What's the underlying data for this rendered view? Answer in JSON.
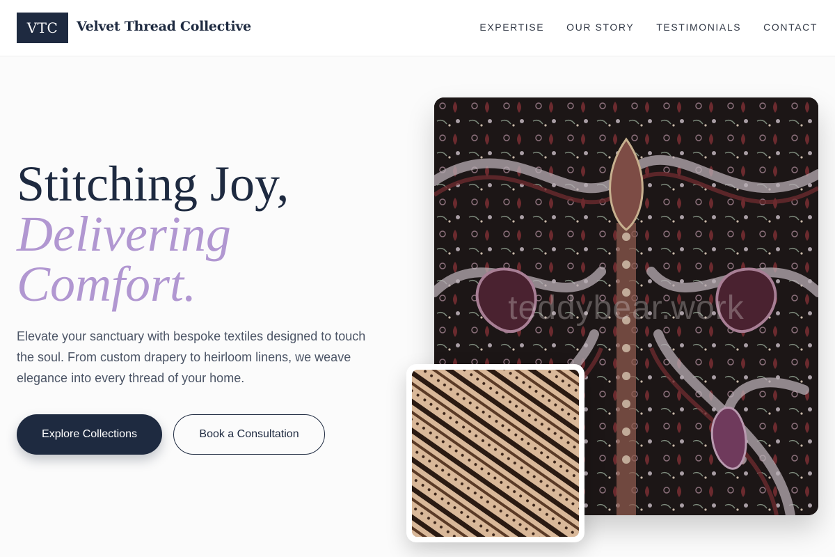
{
  "brand": {
    "logo_text": "VTC",
    "name": "Velvet Thread Collective"
  },
  "nav": {
    "items": [
      {
        "label": "EXPERTISE"
      },
      {
        "label": "OUR STORY"
      },
      {
        "label": "TESTIMONIALS"
      },
      {
        "label": "CONTACT"
      }
    ]
  },
  "hero": {
    "title_line1": "Stitching Joy,",
    "title_line2": "Delivering",
    "title_line3": "Comfort.",
    "description": "Elevate your sanctuary with bespoke textiles designed to touch the soul. From custom drapery to heirloom linens, we weave elegance into every thread of your home.",
    "primary_button": "Explore Collections",
    "secondary_button": "Book a Consultation"
  },
  "images": {
    "main_watermark": "teddybear.work"
  },
  "colors": {
    "navy": "#1e2a40",
    "lavender_accent": "#b197d1",
    "background": "#fbfbfb"
  }
}
